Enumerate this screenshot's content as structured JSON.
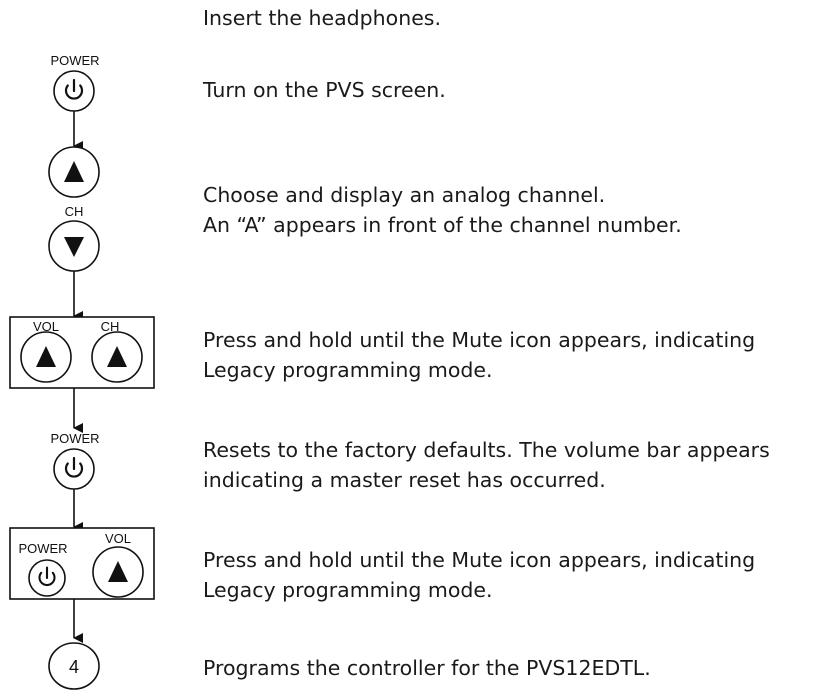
{
  "buttons": {
    "power_label": "POWER",
    "ch_label": "CH",
    "vol_label": "VOL",
    "digit_4": "4"
  },
  "steps": [
    {
      "lines": [
        "Insert the headphones."
      ]
    },
    {
      "lines": [
        "Turn on the PVS screen."
      ]
    },
    {
      "lines": [
        "Choose and display an analog channel.",
        "An “A” appears in front of the channel number."
      ]
    },
    {
      "lines": [
        "Press and hold until the Mute icon appears, indicating",
        "Legacy programming mode."
      ]
    },
    {
      "lines": [
        "Resets to the factory defaults. The volume bar appears",
        "indicating a master reset has occurred."
      ]
    },
    {
      "lines": [
        "Press and hold until the Mute icon appears, indicating",
        "Legacy programming mode."
      ]
    },
    {
      "lines": [
        "Programs the controller for the PVS12EDTL."
      ]
    }
  ],
  "icons": {
    "power": "power-icon",
    "up": "triangle-up-icon",
    "down": "triangle-down-icon",
    "arrow": "arrow-down-icon"
  }
}
